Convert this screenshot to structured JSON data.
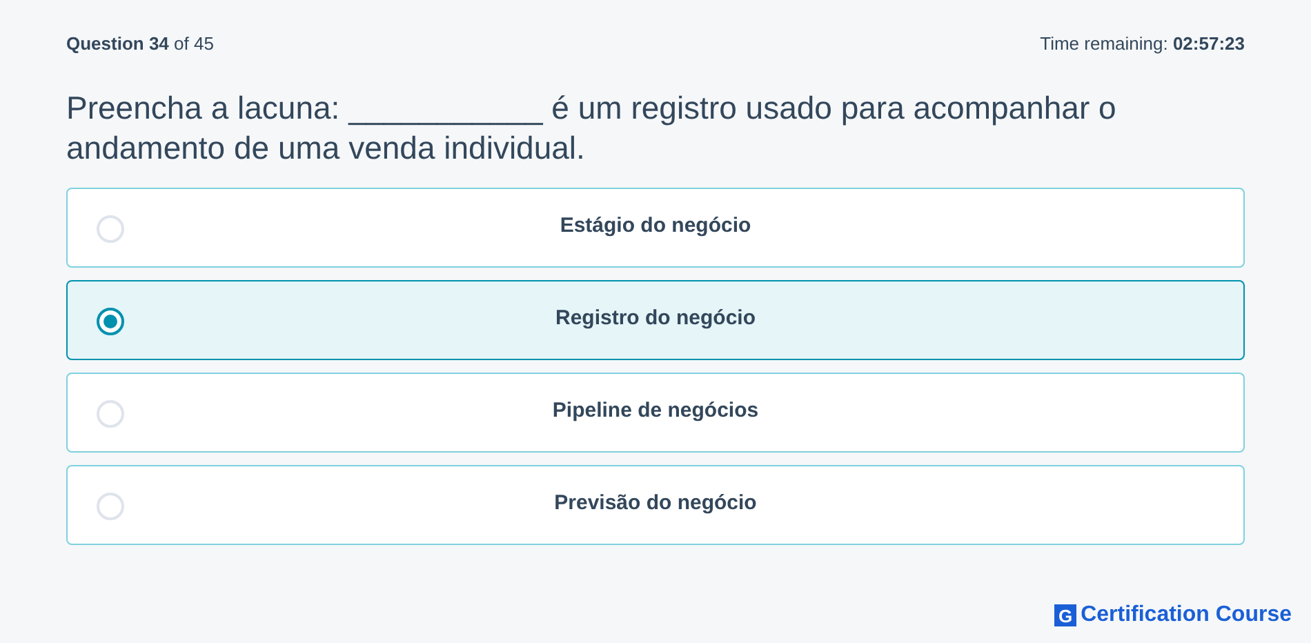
{
  "header": {
    "progress": "**Question 34** of 45",
    "timer": "Time remaining: **02:57:23**"
  },
  "question": "Preencha a lacuna: ___________ é um registro usado para acompanhar o andamento de uma venda individual.",
  "options": [
    {
      "label": "Estágio do negócio",
      "selected": false
    },
    {
      "label": "Registro do negócio",
      "selected": true
    },
    {
      "label": "Pipeline de negócios",
      "selected": false
    },
    {
      "label": "Previsão do negócio",
      "selected": false
    }
  ],
  "brand": {
    "mark": "G",
    "name": "Certification Course"
  }
}
